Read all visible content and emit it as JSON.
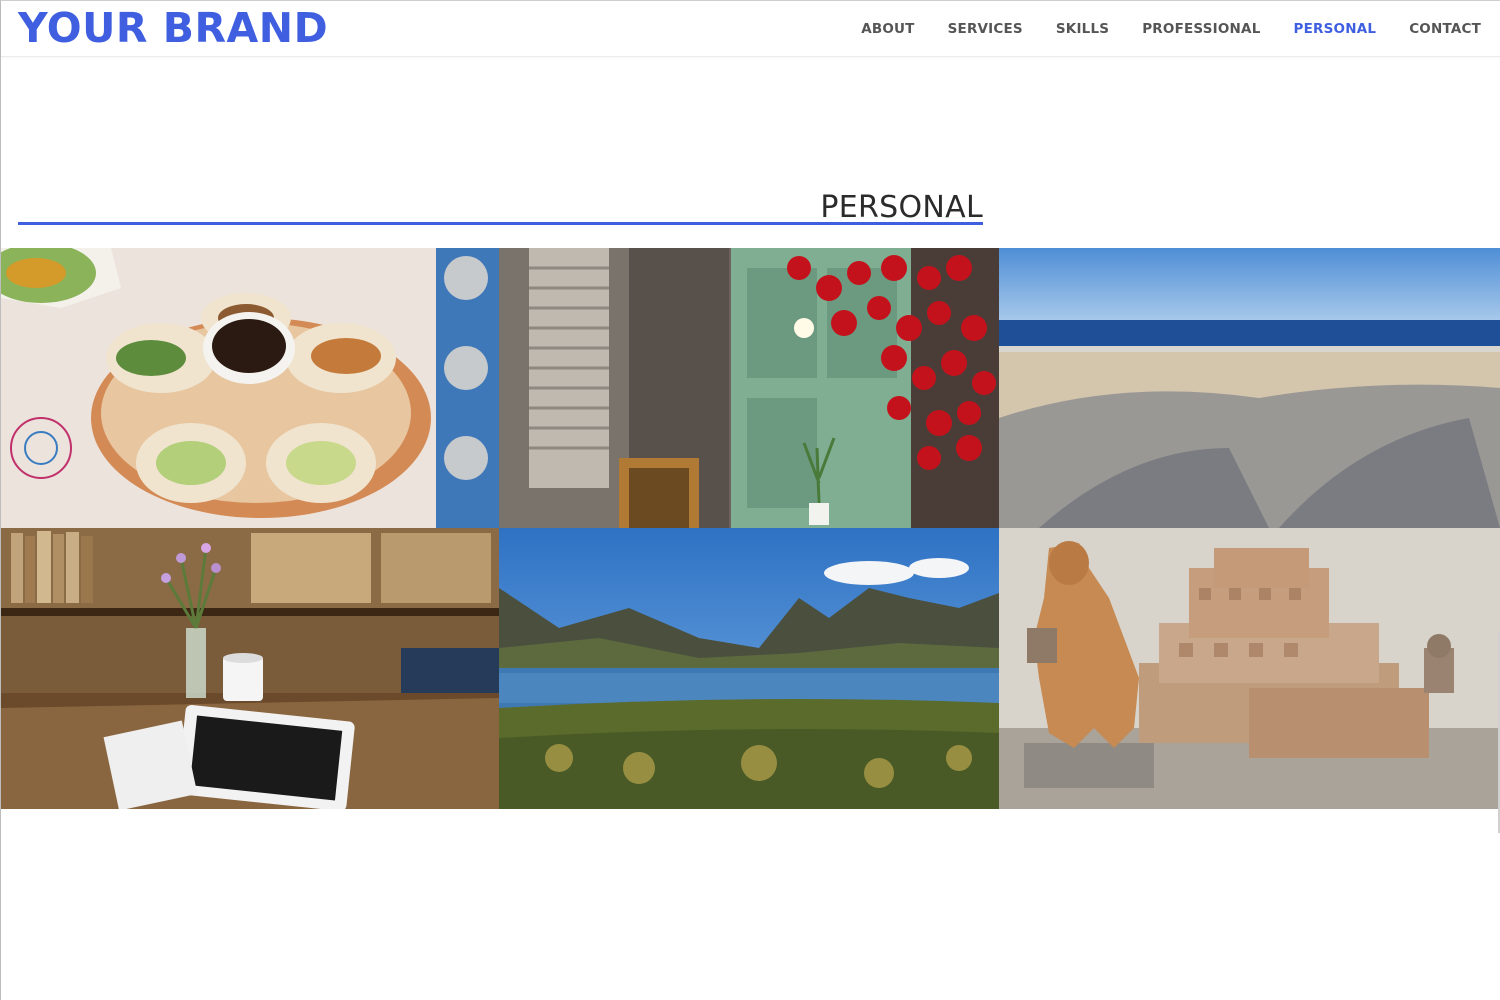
{
  "header": {
    "brand": "YOUR BRAND",
    "nav": [
      {
        "label": "ABOUT",
        "active": false
      },
      {
        "label": "SERVICES",
        "active": false
      },
      {
        "label": "SKILLS",
        "active": false
      },
      {
        "label": "PROFESSIONAL",
        "active": false
      },
      {
        "label": "PERSONAL",
        "active": true
      },
      {
        "label": "CONTACT",
        "active": false
      }
    ]
  },
  "section": {
    "title": "PERSONAL"
  },
  "gallery": {
    "photos": [
      {
        "subject": "tacos-platter-photo"
      },
      {
        "subject": "red-bells-door-photo"
      },
      {
        "subject": "beach-palm-shadows-photo"
      },
      {
        "subject": "bookshelf-desk-photo"
      },
      {
        "subject": "mountain-lake-photo"
      },
      {
        "subject": "stone-sculptures-photo"
      }
    ]
  },
  "colors": {
    "accent": "#3f5fe0",
    "nav_text": "#555555",
    "title_text": "#2b2b2b"
  }
}
